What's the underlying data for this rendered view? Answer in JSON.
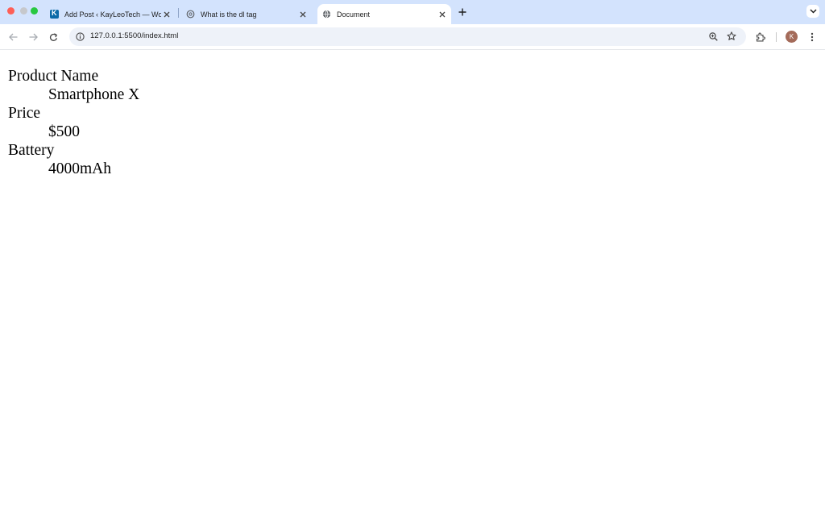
{
  "browser": {
    "tabs": [
      {
        "title": "Add Post ‹ KayLeoTech — Wo",
        "favicon": "kayleotech-k-icon",
        "active": false
      },
      {
        "title": "What is the dl tag",
        "favicon": "chatgpt-icon",
        "active": false
      },
      {
        "title": "Document",
        "favicon": "globe-icon",
        "active": true
      }
    ],
    "url": "127.0.0.1:5500/index.html",
    "profile_initial": "K"
  },
  "page": {
    "definition_list": [
      {
        "term": "Product Name",
        "description": "Smartphone X"
      },
      {
        "term": "Price",
        "description": "$500"
      },
      {
        "term": "Battery",
        "description": "4000mAh"
      }
    ]
  }
}
